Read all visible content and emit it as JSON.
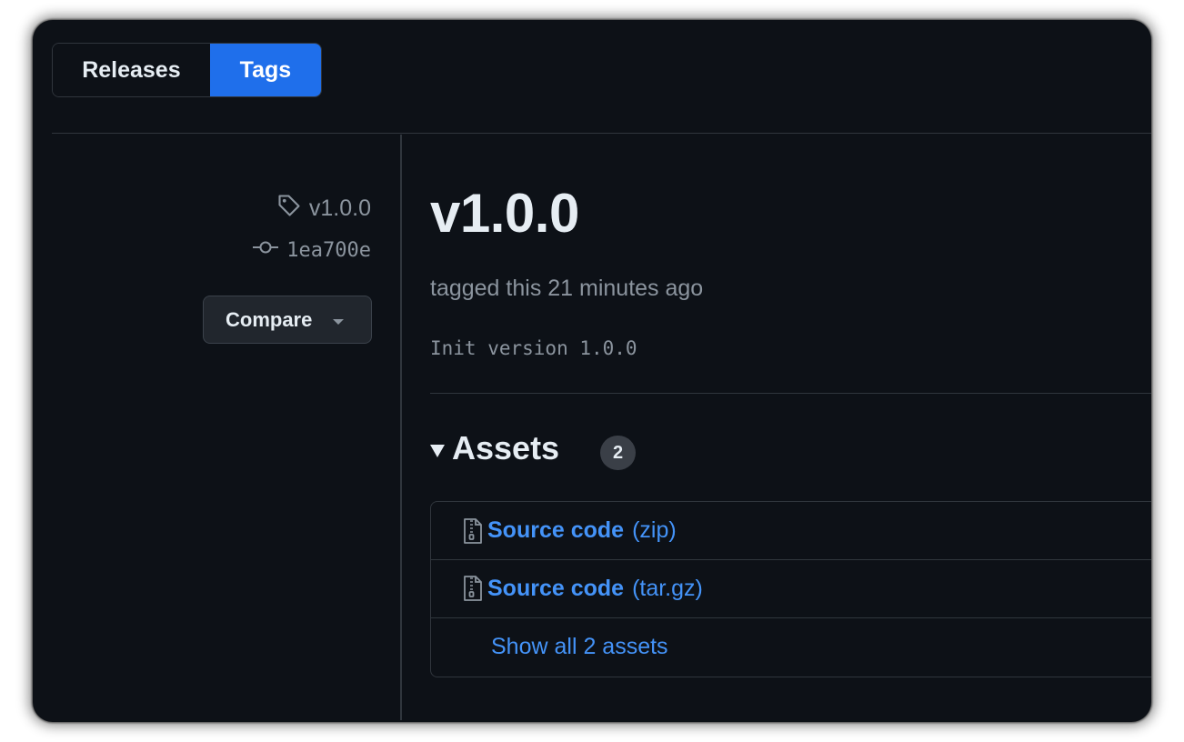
{
  "tabs": {
    "releases_label": "Releases",
    "tags_label": "Tags",
    "active": "Tags"
  },
  "sidebar": {
    "tag_name": "v1.0.0",
    "tag_icon": "tag-icon",
    "commit_sha": "1ea700e",
    "commit_icon": "git-commit-icon",
    "compare_label": "Compare",
    "compare_icon": "triangle-down-icon"
  },
  "release": {
    "title": "v1.0.0",
    "tagged_text": "tagged this 21 minutes ago",
    "message": "Init version 1.0.0"
  },
  "assets": {
    "title": "Assets",
    "count": "2",
    "items": [
      {
        "name": "Source code",
        "ext": "(zip)",
        "icon": "file-zip-icon"
      },
      {
        "name": "Source code",
        "ext": "(tar.gz)",
        "icon": "file-zip-icon"
      }
    ],
    "show_all_label": "Show all 2 assets"
  },
  "colors": {
    "background": "#0d1117",
    "accent": "#1f6feb",
    "link": "#4493f8",
    "muted_text": "#8b949e",
    "border": "#30363d"
  }
}
